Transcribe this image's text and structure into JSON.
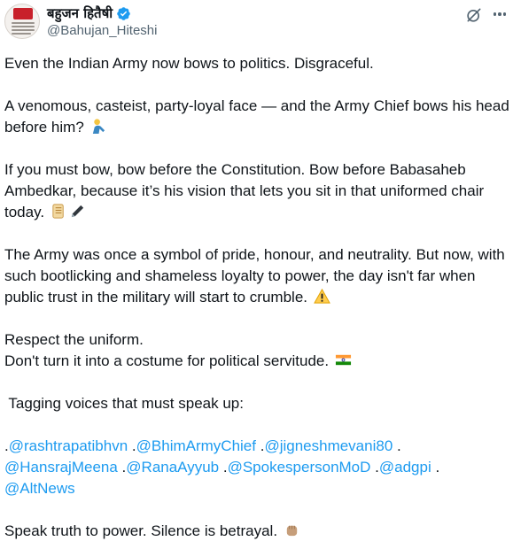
{
  "author": {
    "display_name": "बहुजन हितैषी",
    "handle": "@Bahujan_Hiteshi",
    "avatar_icon": "profile-avatar",
    "verified_icon": "verified-badge-icon",
    "verified_color": "#1d9bf0"
  },
  "actions": {
    "grok_icon": "grok-icon",
    "more_icon": "more-options-icon"
  },
  "tweet": {
    "line1": "Even the Indian Army now bows to politics. Disgraceful.",
    "line2": "A venomous, casteist, party-loyal face — and the Army Chief bows his head before him?",
    "line3": "If you must bow, bow before the Constitution. Bow before Babasaheb Ambedkar, because it’s his vision that lets you sit in that uniformed chair today.",
    "line4": "The Army was once a symbol of pride, honour, and neutrality. But now, with such bootlicking and shameless loyalty to power, the day isn't far when public trust in the military will start to crumble.",
    "line5a": "Respect the uniform.",
    "line5b": "Don't turn it into a costume for political servitude.",
    "line6": " Tagging voices that must speak up:",
    "mentions": [
      "@rashtrapatibhvn",
      "@BhimArmyChief",
      "@jigneshmevani80",
      "@HansrajMeena",
      "@RanaAyyub",
      "@SpokespersonMoD",
      "@adgpi",
      "@AltNews"
    ],
    "line8": "Speak truth to power. Silence is betrayal.",
    "emojis": [
      "person-bowing-emoji",
      "scroll-emoji",
      "pen-emoji",
      "warning-emoji",
      "india-flag-emoji",
      "raised-fist-emoji"
    ]
  },
  "colors": {
    "text": "#0f1419",
    "secondary": "#536471",
    "link": "#1d9bf0"
  }
}
